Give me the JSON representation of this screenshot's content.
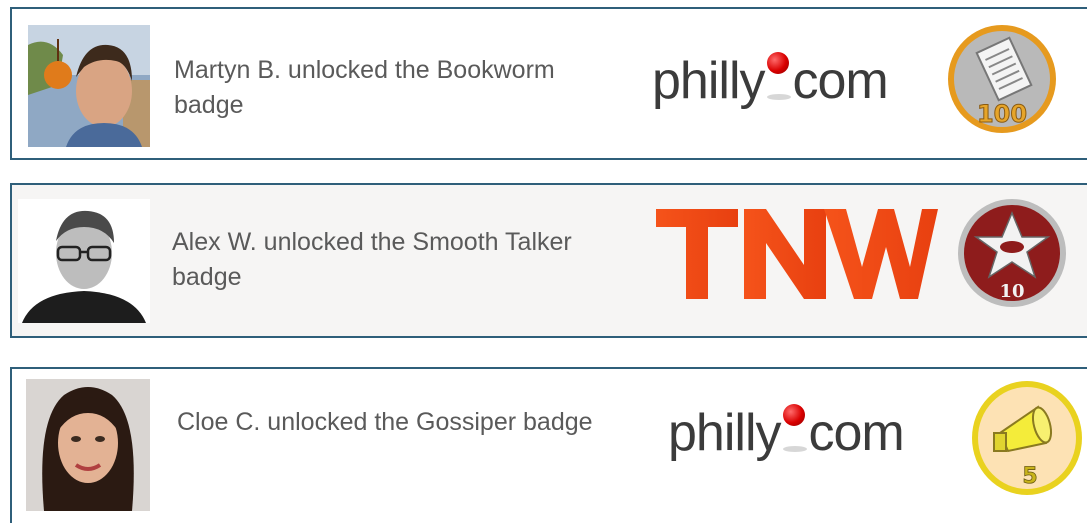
{
  "feed": [
    {
      "message": "Martyn B. unlocked the Bookworm badge",
      "site_logo": "philly.com",
      "badge": {
        "icon": "newspaper-icon",
        "count": "100",
        "color": "#b9b9b9",
        "ring": "#e69a1e"
      }
    },
    {
      "message": "Alex W. unlocked the Smooth Talker badge",
      "site_logo": "TNW",
      "badge": {
        "icon": "star-icon",
        "count": "10",
        "color": "#8e1c1c",
        "ring": "#bdbdbd"
      }
    },
    {
      "message": "Cloe C. unlocked the Gossiper badge",
      "site_logo": "philly.com",
      "badge": {
        "icon": "megaphone-icon",
        "count": "5",
        "color": "#fde2b4",
        "ring": "#e9d21f"
      }
    }
  ],
  "colors": {
    "card_border": "#2f5f7a",
    "text": "#5a5a5a",
    "tnw_orange": "#f04e12"
  }
}
